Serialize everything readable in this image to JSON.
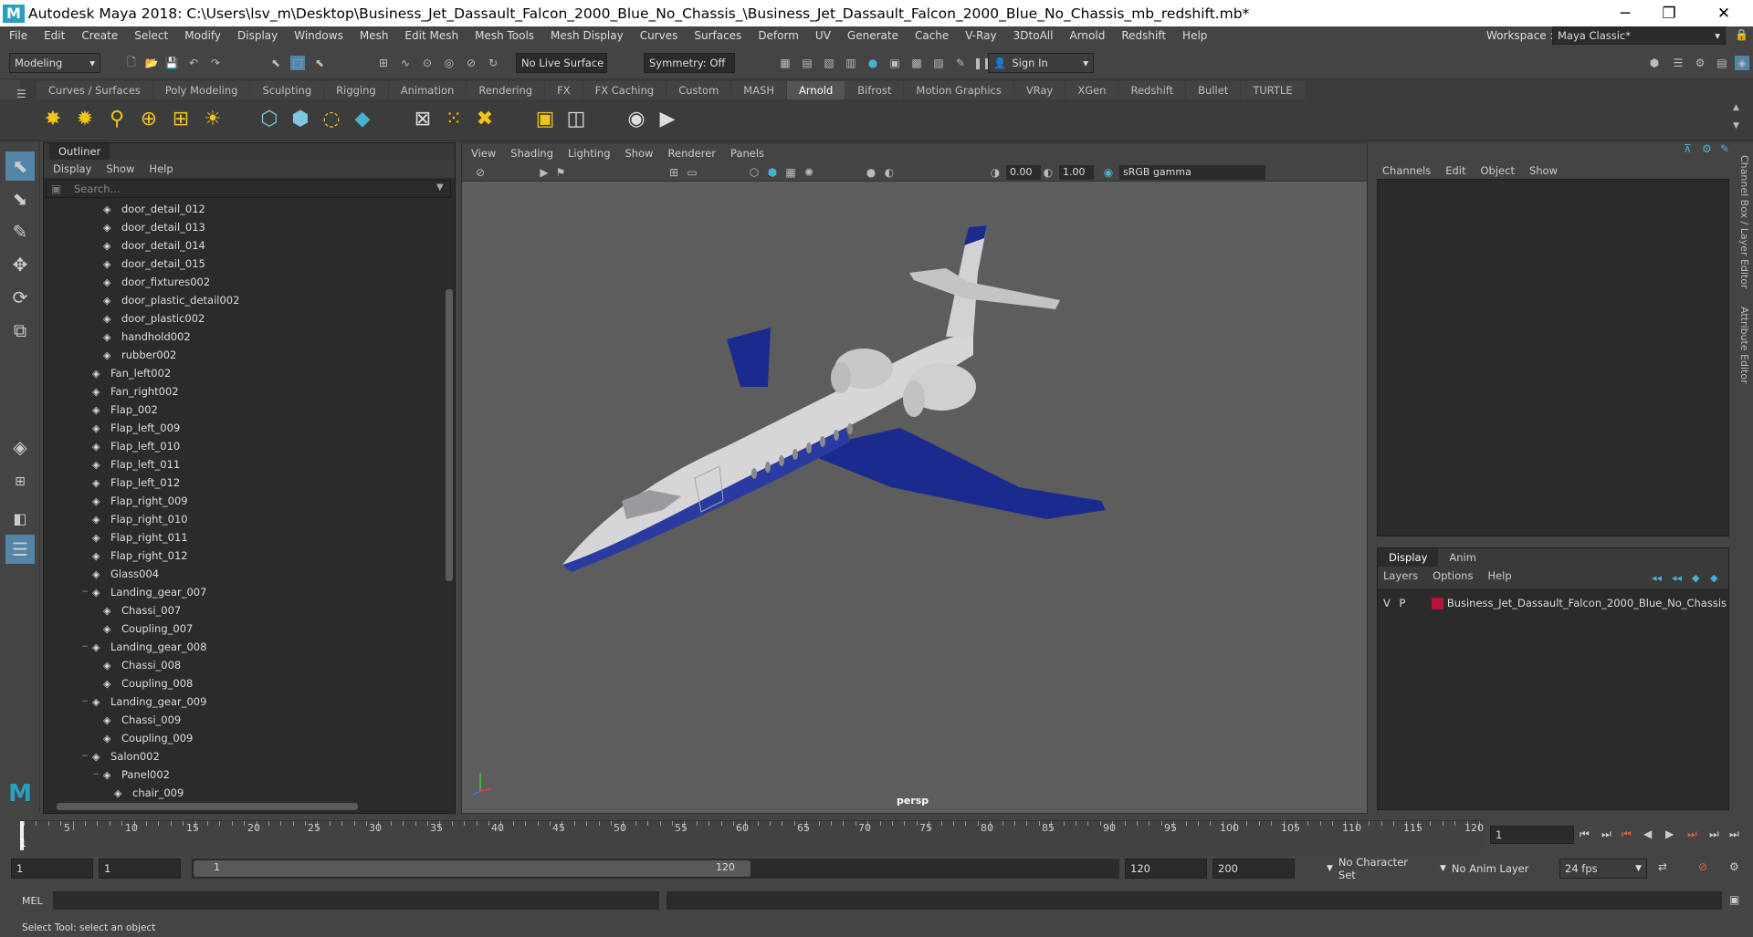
{
  "title_bar": {
    "title": "Autodesk Maya 2018: C:\\Users\\lsv_m\\Desktop\\Business_Jet_Dassault_Falcon_2000_Blue_No_Chassis_\\Business_Jet_Dassault_Falcon_2000_Blue_No_Chassis_mb_redshift.mb*",
    "logo": "M"
  },
  "menubar": {
    "items": [
      "File",
      "Edit",
      "Create",
      "Select",
      "Modify",
      "Display",
      "Windows",
      "Mesh",
      "Edit Mesh",
      "Mesh Tools",
      "Mesh Display",
      "Curves",
      "Surfaces",
      "Deform",
      "UV",
      "Generate",
      "Cache",
      "V-Ray",
      "3DtoAll",
      "Arnold",
      "Redshift",
      "Help"
    ],
    "workspace_label": "Workspace :",
    "workspace_value": "Maya Classic*"
  },
  "status_line": {
    "mode": "Modeling",
    "live_surface": "No Live Surface",
    "symmetry": "Symmetry: Off",
    "sign_in": "Sign In"
  },
  "shelf": {
    "tabs": [
      "Curves / Surfaces",
      "Poly Modeling",
      "Sculpting",
      "Rigging",
      "Animation",
      "Rendering",
      "FX",
      "FX Caching",
      "Custom",
      "MASH",
      "Arnold",
      "Bifrost",
      "Motion Graphics",
      "VRay",
      "XGen",
      "Redshift",
      "Bullet",
      "TURTLE"
    ],
    "active_tab": "Arnold"
  },
  "outliner": {
    "tab": "Outliner",
    "menu": [
      "Display",
      "Show",
      "Help"
    ],
    "search_placeholder": "Search...",
    "items": [
      {
        "label": "door_detail_012",
        "depth": 2,
        "toggle": ""
      },
      {
        "label": "door_detail_013",
        "depth": 2,
        "toggle": ""
      },
      {
        "label": "door_detail_014",
        "depth": 2,
        "toggle": ""
      },
      {
        "label": "door_detail_015",
        "depth": 2,
        "toggle": ""
      },
      {
        "label": "door_fixtures002",
        "depth": 2,
        "toggle": ""
      },
      {
        "label": "door_plastic_detail002",
        "depth": 2,
        "toggle": ""
      },
      {
        "label": "door_plastic002",
        "depth": 2,
        "toggle": ""
      },
      {
        "label": "handhold002",
        "depth": 2,
        "toggle": ""
      },
      {
        "label": "rubber002",
        "depth": 2,
        "toggle": ""
      },
      {
        "label": "Fan_left002",
        "depth": 1,
        "toggle": ""
      },
      {
        "label": "Fan_right002",
        "depth": 1,
        "toggle": ""
      },
      {
        "label": "Flap_002",
        "depth": 1,
        "toggle": ""
      },
      {
        "label": "Flap_left_009",
        "depth": 1,
        "toggle": ""
      },
      {
        "label": "Flap_left_010",
        "depth": 1,
        "toggle": ""
      },
      {
        "label": "Flap_left_011",
        "depth": 1,
        "toggle": ""
      },
      {
        "label": "Flap_left_012",
        "depth": 1,
        "toggle": ""
      },
      {
        "label": "Flap_right_009",
        "depth": 1,
        "toggle": ""
      },
      {
        "label": "Flap_right_010",
        "depth": 1,
        "toggle": ""
      },
      {
        "label": "Flap_right_011",
        "depth": 1,
        "toggle": ""
      },
      {
        "label": "Flap_right_012",
        "depth": 1,
        "toggle": ""
      },
      {
        "label": "Glass004",
        "depth": 1,
        "toggle": ""
      },
      {
        "label": "Landing_gear_007",
        "depth": 1,
        "toggle": "−"
      },
      {
        "label": "Chassi_007",
        "depth": 2,
        "toggle": ""
      },
      {
        "label": "Coupling_007",
        "depth": 2,
        "toggle": ""
      },
      {
        "label": "Landing_gear_008",
        "depth": 1,
        "toggle": "−"
      },
      {
        "label": "Chassi_008",
        "depth": 2,
        "toggle": ""
      },
      {
        "label": "Coupling_008",
        "depth": 2,
        "toggle": ""
      },
      {
        "label": "Landing_gear_009",
        "depth": 1,
        "toggle": "−"
      },
      {
        "label": "Chassi_009",
        "depth": 2,
        "toggle": ""
      },
      {
        "label": "Coupling_009",
        "depth": 2,
        "toggle": ""
      },
      {
        "label": "Salon002",
        "depth": 1,
        "toggle": "−"
      },
      {
        "label": "Panel002",
        "depth": 2,
        "toggle": "−"
      },
      {
        "label": "chair_009",
        "depth": 3,
        "toggle": ""
      }
    ]
  },
  "viewport": {
    "menu": [
      "View",
      "Shading",
      "Lighting",
      "Show",
      "Renderer",
      "Panels"
    ],
    "value_a": "0.00",
    "value_b": "1.00",
    "color_space": "sRGB gamma",
    "camera": "persp"
  },
  "channel_box": {
    "menu": [
      "Channels",
      "Edit",
      "Object",
      "Show"
    ]
  },
  "layer_editor": {
    "tabs": [
      "Display",
      "Anim"
    ],
    "active_tab": "Display",
    "menu": [
      "Layers",
      "Options",
      "Help"
    ],
    "layer": {
      "v": "V",
      "p": "P",
      "name": "Business_Jet_Dassault_Falcon_2000_Blue_No_Chassis",
      "color": "#b8123a"
    }
  },
  "side_tabs": [
    "Channel Box / Layer Editor",
    "Attribute Editor"
  ],
  "timeline": {
    "ticks": [
      "5",
      "10",
      "15",
      "20",
      "25",
      "30",
      "35",
      "40",
      "45",
      "50",
      "55",
      "60",
      "65",
      "70",
      "75",
      "80",
      "85",
      "90",
      "95",
      "100",
      "105",
      "110",
      "115",
      "120"
    ],
    "current_frame_marker": "1",
    "current_frame": "1"
  },
  "range": {
    "start": "1",
    "playback_start": "1",
    "slider_start": "1",
    "slider_end": "120",
    "playback_end": "120",
    "end": "200",
    "character_set": "No Character Set",
    "anim_layer": "No Anim Layer",
    "fps": "24 fps"
  },
  "command_line": {
    "label": "MEL"
  },
  "help_line": "Select Tool: select an object",
  "colors": {
    "accent": "#5285a6",
    "jet_blue": "#1b2a8f",
    "fuselage": "#d6d6d8",
    "viewport_bg": "#5d5d5d"
  }
}
